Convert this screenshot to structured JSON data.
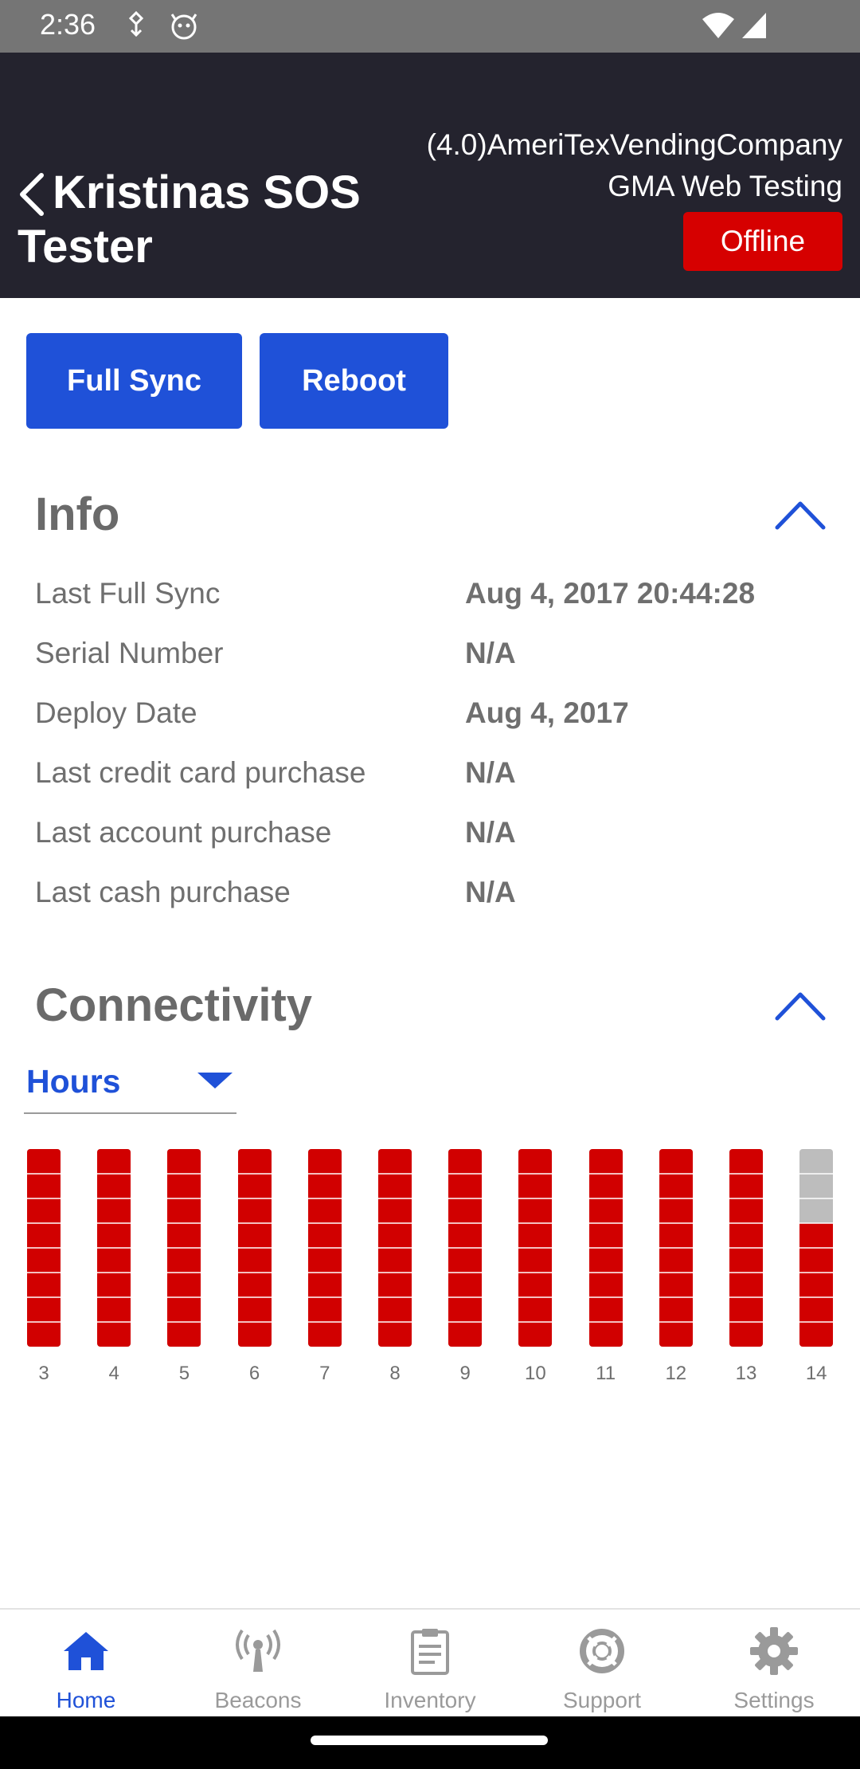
{
  "status_bar": {
    "time": "2:36"
  },
  "header": {
    "title": "Kristinas SOS Tester",
    "company_line1": "(4.0)AmeriTexVendingCompany",
    "company_line2": "GMA Web Testing",
    "status": "Offline"
  },
  "actions": {
    "full_sync": "Full Sync",
    "reboot": "Reboot"
  },
  "info": {
    "title": "Info",
    "rows": [
      {
        "label": "Last Full Sync",
        "value": "Aug 4, 2017 20:44:28"
      },
      {
        "label": "Serial Number",
        "value": "N/A"
      },
      {
        "label": "Deploy Date",
        "value": "Aug 4, 2017"
      },
      {
        "label": "Last credit card purchase",
        "value": "N/A"
      },
      {
        "label": "Last account purchase",
        "value": "N/A"
      },
      {
        "label": "Last cash purchase",
        "value": "N/A"
      }
    ]
  },
  "connectivity": {
    "title": "Connectivity",
    "range_select": "Hours"
  },
  "chart_data": {
    "type": "bar",
    "categories": [
      "3",
      "4",
      "5",
      "6",
      "7",
      "8",
      "9",
      "10",
      "11",
      "12",
      "13",
      "14"
    ],
    "segments_per_bar": 8,
    "values": [
      8,
      8,
      8,
      8,
      8,
      8,
      8,
      8,
      8,
      8,
      8,
      5
    ],
    "ylim": [
      0,
      8
    ],
    "colors": {
      "filled": "#d10000",
      "empty": "#bdbdbd"
    }
  },
  "bottom_nav": [
    {
      "label": "Home",
      "icon": "home-icon",
      "active": true
    },
    {
      "label": "Beacons",
      "icon": "beacon-icon",
      "active": false
    },
    {
      "label": "Inventory",
      "icon": "clipboard-icon",
      "active": false
    },
    {
      "label": "Support",
      "icon": "lifebuoy-icon",
      "active": false
    },
    {
      "label": "Settings",
      "icon": "gear-icon",
      "active": false
    }
  ],
  "colors": {
    "accent": "#1f51d8",
    "header_bg": "#24232e",
    "offline": "#d60000"
  }
}
